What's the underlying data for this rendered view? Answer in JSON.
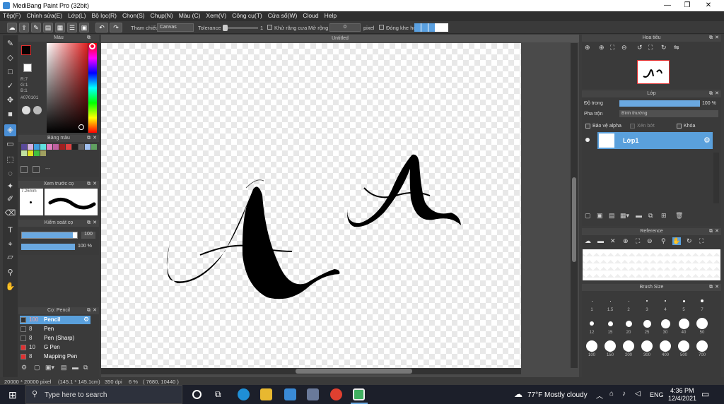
{
  "window": {
    "title": "MediBang Paint Pro (32bit)"
  },
  "menu": [
    "Tệp(F)",
    "Chỉnh sửa(E)",
    "Lớp(L)",
    "Bộ lọc(R)",
    "Chọn(S)",
    "Chụp(N)",
    "Màu (C)",
    "Xem(V)",
    "Công cụ(T)",
    "Cửa sổ(W)",
    "Cloud",
    "Help"
  ],
  "toolbar": {
    "ref_label": "Tham chiếu",
    "ref_value": "Canvas",
    "tolerance_label": "Tolerance",
    "tolerance_value": "1",
    "antialias_label": "Khử răng cưa",
    "expand_label": "Mở rộng",
    "expand_value": "0",
    "expand_unit": "pixel",
    "close_gap_label": "Đóng khe hở"
  },
  "color_panel": {
    "title": "Màu",
    "r": "R:7",
    "g": "G:1",
    "b": "B:1",
    "hex": "#070101",
    "fg": "#070101",
    "bg": "#ffffff"
  },
  "palette": {
    "title": "Bảng màu",
    "colors": [
      "#5a4a9a",
      "#d0b0e0",
      "#40a0e0",
      "#60e0e0",
      "#e080c0",
      "#c060a0",
      "#a02020",
      "#e04040",
      "#202020",
      "#606060",
      "#a0c0f0",
      "#60a060",
      "#c0e0a0",
      "#e0e020",
      "#40c040",
      "#a0a060"
    ],
    "more": "---"
  },
  "brush_preview": {
    "title": "Xem trước cọ",
    "size": "7.26mm"
  },
  "brush_control": {
    "title": "Kiểm soát cọ",
    "size_value": "100",
    "opacity_value": "100 %"
  },
  "brush_list": {
    "title": "Cọ: Pencil",
    "items": [
      {
        "size": "100",
        "name": "Pencil",
        "color": "#333333"
      },
      {
        "size": "8",
        "name": "Pen",
        "color": "#333333"
      },
      {
        "size": "8",
        "name": "Pen (Sharp)",
        "color": "#333333"
      },
      {
        "size": "10",
        "name": "G Pen",
        "color": "#e03030"
      },
      {
        "size": "8",
        "name": "Mapping Pen",
        "color": "#e03030"
      }
    ]
  },
  "canvas": {
    "tab": "Untitled"
  },
  "navigator": {
    "title": "Hoa tiêu"
  },
  "layer_panel": {
    "title": "Lớp",
    "opacity_label": "Độ trong",
    "opacity_value": "100 %",
    "blend_label": "Pha trộn",
    "blend_value": "Bình thường",
    "protect_alpha": "Bảo vệ alpha",
    "clip": "Xén bớt",
    "lock": "Khóa",
    "layer_name": "Lớp1"
  },
  "reference": {
    "title": "Reference"
  },
  "brush_size": {
    "title": "Brush Size",
    "row1": [
      "1",
      "1.5",
      "2",
      "3",
      "4",
      "5",
      "7"
    ],
    "row2": [
      "12",
      "15",
      "20",
      "25",
      "30",
      "40",
      "50"
    ],
    "row3": [
      "100",
      "150",
      "200",
      "300",
      "400",
      "500",
      "700"
    ]
  },
  "status": {
    "dims": "20000 * 20000 pixel",
    "cm": "(145.1 * 145.1cm)",
    "dpi": "350 dpi",
    "zoom": "6 %",
    "coords": "( 7680, 10440 )"
  },
  "taskbar": {
    "search_placeholder": "Type here to search",
    "weather": "77°F  Mostly cloudy",
    "lang": "ENG",
    "time": "4:36 PM",
    "date": "12/4/2021"
  }
}
